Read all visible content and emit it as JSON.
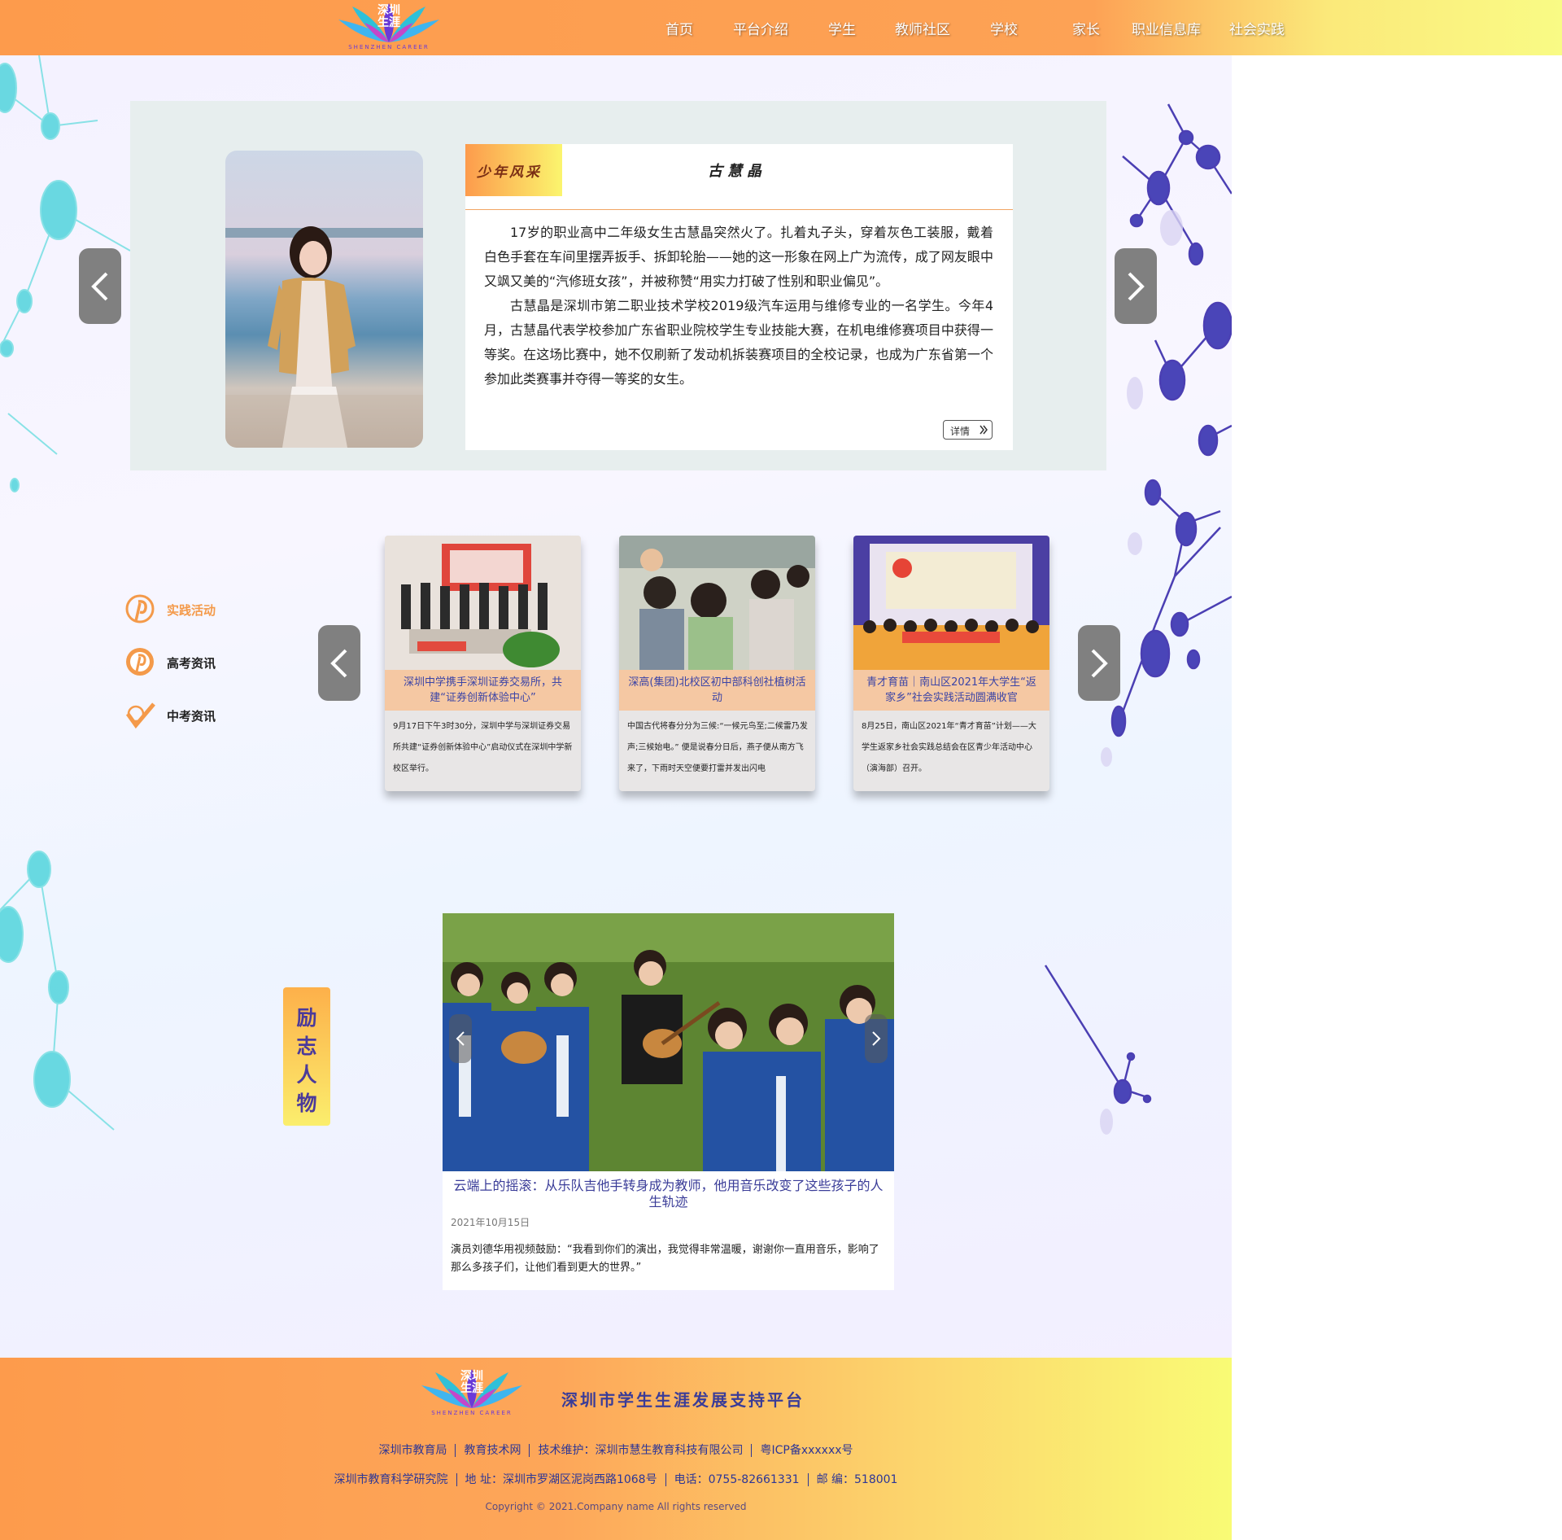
{
  "header": {
    "logo_text_line1": "深圳",
    "logo_text_line2": "生涯",
    "logo_sub": "SHENZHEN CAREER",
    "nav": [
      {
        "label": "首页"
      },
      {
        "label": "平台介绍"
      },
      {
        "label": "学生"
      },
      {
        "label": "教师社区"
      },
      {
        "label": "学校"
      },
      {
        "label": "家长"
      },
      {
        "label": "职业信息库"
      },
      {
        "label": "社会实践"
      }
    ]
  },
  "hero": {
    "tag": "少年风采",
    "name": "古慧晶",
    "paragraphs": [
      "17岁的职业高中二年级女生古慧晶突然火了。扎着丸子头，穿着灰色工装服，戴着白色手套在车间里摆弄扳手、拆卸轮胎——她的这一形象在网上广为流传，成了网友眼中又飒又美的“汽修班女孩”，并被称赞“用实力打破了性别和职业偏见”。",
      "古慧晶是深圳市第二职业技术学校2019级汽车运用与维修专业的一名学生。今年4月，古慧晶代表学校参加广东省职业院校学生专业技能大赛，在机电维修赛项目中获得一等奖。在这场比赛中，她不仅刷新了发动机拆装赛项目的全校记录，也成为广东省第一个参加此类赛事并夺得一等奖的女生。"
    ],
    "detail_label": "详情",
    "detail_icon": "double-chevron-right-icon"
  },
  "side_nav": [
    {
      "label": "实践活动",
      "icon": "pinterest-icon",
      "color": "#f49a4a"
    },
    {
      "label": "高考资讯",
      "icon": "pinterest-icon",
      "color": "#222222"
    },
    {
      "label": "中考资讯",
      "icon": "check-icon",
      "color": "#222222"
    }
  ],
  "activities": [
    {
      "title": "深圳中学携手深圳证券交易所，共建“证券创新体验中心”",
      "desc": "9月17日下午3时30分，深圳中学与深圳证券交易所共建“证券创新体验中心”启动仪式在深圳中学新校区举行。"
    },
    {
      "title": "深高(集团)北校区初中部科创社植树活动",
      "desc": "中国古代将春分分为三候:“一候元鸟至;二候雷乃发声;三候始电。” 便是说春分日后，燕子便从南方飞来了，下雨时天空便要打雷并发出闪电"
    },
    {
      "title": "青才育苗｜南山区2021年大学生“返家乡”社会实践活动圆满收官",
      "desc": "8月25日，南山区2021年“青才育苗”计划——大学生返家乡社会实践总结会在区青少年活动中心（演海部）召开。"
    }
  ],
  "inspire": {
    "ribbon": [
      "励",
      "志",
      "人",
      "物"
    ],
    "title": "云端上的摇滚：从乐队吉他手转身成为教师，他用音乐改变了这些孩子的人生轨迹",
    "date": "2021年10月15日",
    "body": "演员刘德华用视频鼓励：“我看到你们的演出，我觉得非常温暖，谢谢你一直用音乐，影响了那么多孩子们，让他们看到更大的世界。”"
  },
  "footer": {
    "logo_text_line1": "深圳",
    "logo_text_line2": "生涯",
    "logo_sub": "SHENZHEN CAREER",
    "title": "深圳市学生生涯发展支持平台",
    "row1": [
      "深圳市教育局",
      "教育技术网",
      "技术维护：深圳市慧生教育科技有限公司",
      "粤ICP备xxxxxx号"
    ],
    "row2": [
      "深圳市教育科学研究院",
      "地  址：深圳市罗湖区泥岗西路1068号",
      "电话：0755-82661331",
      "邮  编：518001"
    ],
    "copyright": "Copyright © 2021.Company name All rights reserved"
  },
  "colors": {
    "brand_orange": "#fd9b4c",
    "brand_yellow": "#f9fb85",
    "title_blue": "#3a3c98"
  }
}
